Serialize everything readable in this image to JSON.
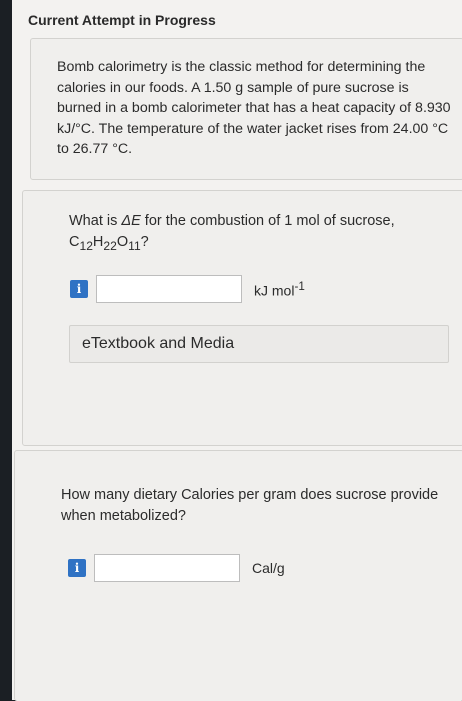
{
  "header": {
    "title": "Current Attempt in Progress"
  },
  "intro": {
    "text": "Bomb calorimetry is the classic method for determining the calories in our foods. A 1.50 g sample of pure sucrose is burned in a bomb calorimeter that has a heat capacity of 8.930 kJ/°C. The temperature of the water jacket rises from 24.00 °C to 26.77 °C."
  },
  "question1": {
    "text_before": "What is ",
    "delta_e": "ΔE",
    "text_after": " for the combustion of 1 mol of sucrose,",
    "formula": {
      "c": "C",
      "c_sub": "12",
      "h": "H",
      "h_sub": "22",
      "o": "O",
      "o_sub": "11",
      "end": "?"
    },
    "info_label": "i",
    "input_value": "",
    "unit_base": "kJ mol",
    "unit_exp": "-1",
    "etextbook_label": "eTextbook and Media"
  },
  "question2": {
    "text": "How many dietary Calories per gram does sucrose provide when metabolized?",
    "info_label": "i",
    "input_value": "",
    "unit": "Cal/g"
  }
}
